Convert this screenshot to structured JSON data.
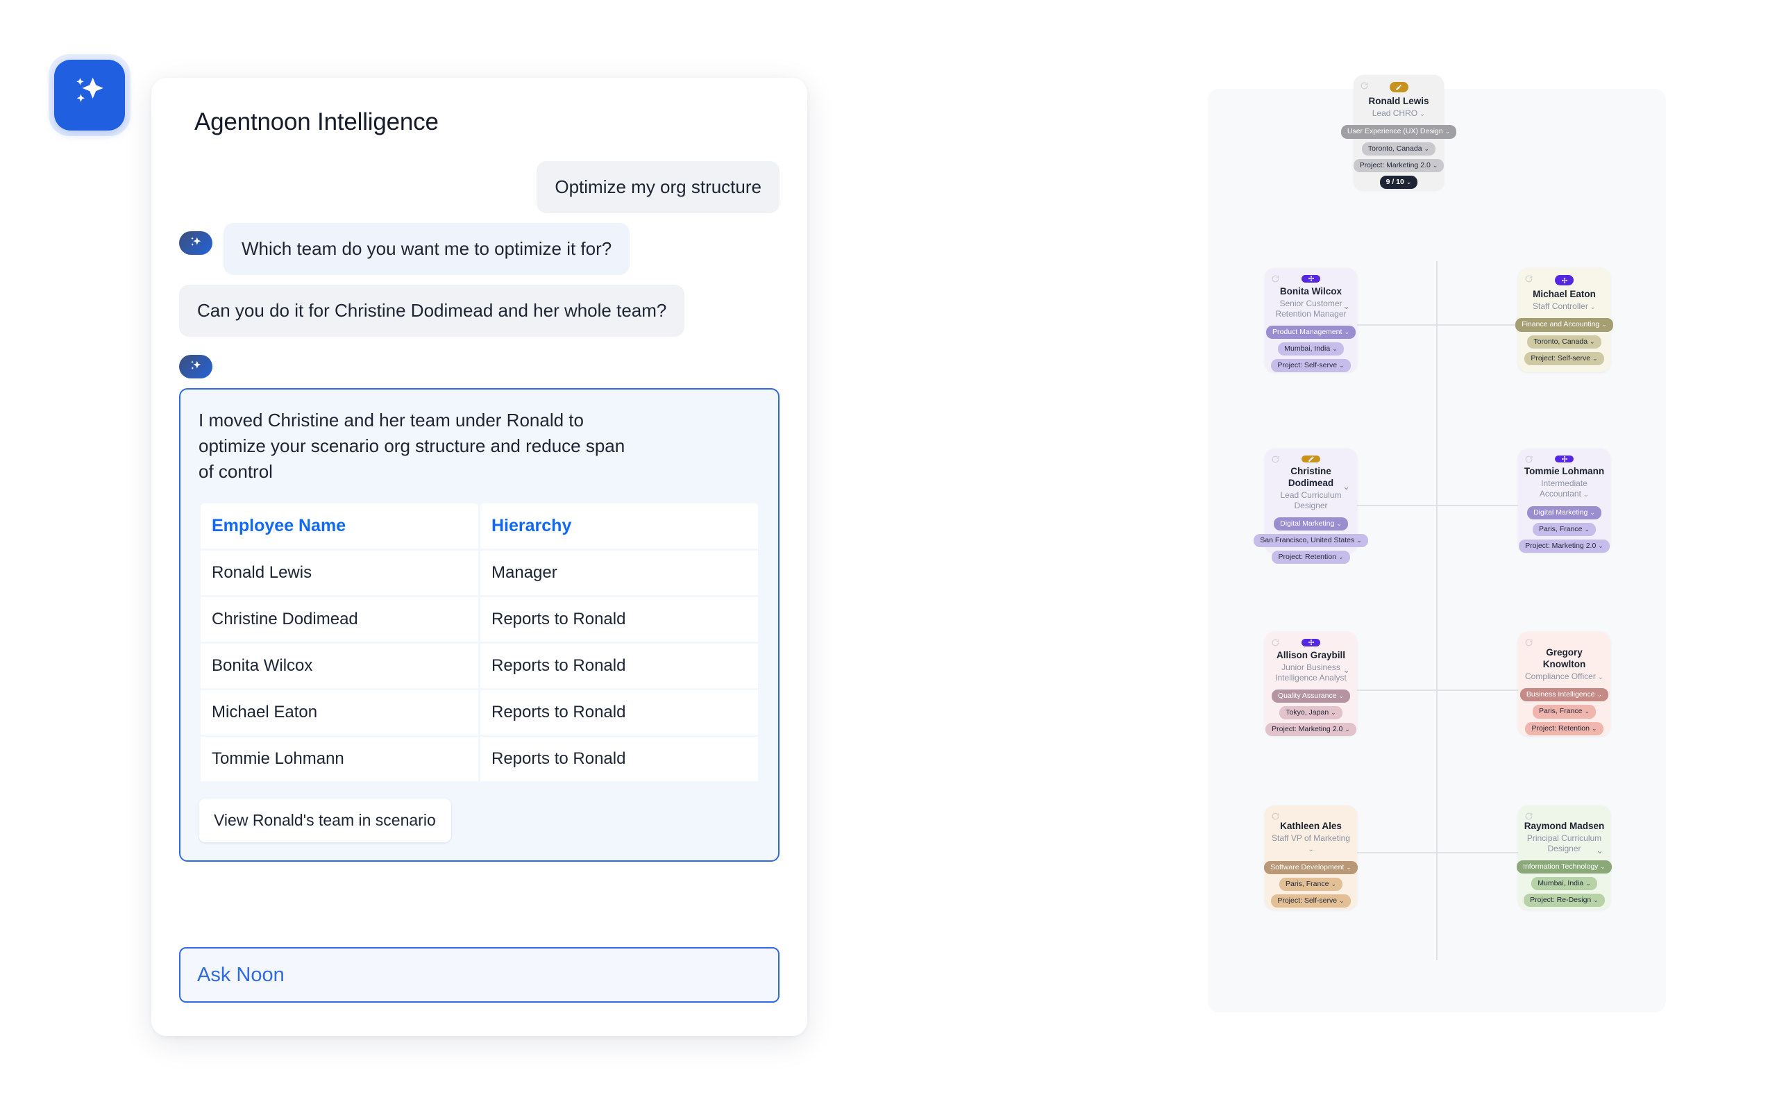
{
  "launcher": {
    "icon": "sparkle-icon"
  },
  "chat": {
    "title": "Agentnoon Intelligence",
    "messages": [
      {
        "role": "user",
        "text": "Optimize my org structure"
      },
      {
        "role": "assistant",
        "text": "Which team do you want me to optimize it for?"
      },
      {
        "role": "user",
        "text": "Can you do it for Christine Dodimead and her whole team?"
      }
    ],
    "answer": {
      "text": "I moved Christine and her team under Ronald to optimize your scenario org structure and reduce span of control",
      "table": {
        "headers": [
          "Employee Name",
          "Hierarchy"
        ],
        "rows": [
          [
            "Ronald Lewis",
            "Manager"
          ],
          [
            "Christine Dodimead",
            "Reports to Ronald"
          ],
          [
            "Bonita Wilcox",
            "Reports to Ronald"
          ],
          [
            "Michael Eaton",
            "Reports to Ronald"
          ],
          [
            "Tommie Lohmann",
            "Reports to Ronald"
          ]
        ]
      },
      "cta_label": "View Ronald's team in scenario"
    },
    "input": {
      "placeholder": "Ask Noon",
      "value": ""
    }
  },
  "org_chart": {
    "nodes": [
      {
        "name": "Ronald Lewis",
        "title": "Lead CHRO",
        "badge": "edit-icon",
        "chips": [
          {
            "label": "User Experience (UX) Design",
            "style": "dept"
          },
          {
            "label": "Toronto, Canada",
            "style": "meta"
          },
          {
            "label": "Project: Marketing 2.0",
            "style": "meta"
          }
        ],
        "count_chip": "9 / 10",
        "colors": {
          "bg": "#f1f1f1",
          "dept": "#a0a0a4",
          "meta": "#c9c9cd"
        }
      },
      {
        "name": "Bonita Wilcox",
        "title": "Senior Customer Retention Manager",
        "badge": "move-icon",
        "chips": [
          {
            "label": "Product Management",
            "style": "dept"
          },
          {
            "label": "Mumbai, India",
            "style": "meta"
          },
          {
            "label": "Project: Self-serve",
            "style": "meta"
          }
        ],
        "colors": {
          "bg": "#f2effb",
          "dept": "#9b8ed0",
          "meta": "#c7bdea"
        }
      },
      {
        "name": "Michael Eaton",
        "title": "Staff Controller",
        "badge": "move-icon",
        "chips": [
          {
            "label": "Finance and Accounting",
            "style": "dept"
          },
          {
            "label": "Toronto, Canada",
            "style": "meta"
          },
          {
            "label": "Project: Self-serve",
            "style": "meta"
          }
        ],
        "colors": {
          "bg": "#f7f6e8",
          "dept": "#a49e72",
          "meta": "#cfcaa3"
        }
      },
      {
        "name": "Christine Dodimead",
        "title": "Lead Curriculum Designer",
        "badge": "edit-icon",
        "chips": [
          {
            "label": "Digital Marketing",
            "style": "dept"
          },
          {
            "label": "San Francisco, United States",
            "style": "meta"
          },
          {
            "label": "Project: Retention",
            "style": "meta"
          }
        ],
        "colors": {
          "bg": "#f2effb",
          "dept": "#9b8ed0",
          "meta": "#c7bdea"
        }
      },
      {
        "name": "Tommie Lohmann",
        "title": "Intermediate Accountant",
        "badge": "move-icon",
        "chips": [
          {
            "label": "Digital Marketing",
            "style": "dept"
          },
          {
            "label": "Paris, France",
            "style": "meta"
          },
          {
            "label": "Project: Marketing 2.0",
            "style": "meta"
          }
        ],
        "colors": {
          "bg": "#f2effb",
          "dept": "#9b8ed0",
          "meta": "#c7bdea"
        }
      },
      {
        "name": "Allison Graybill",
        "title": "Junior Business Intelligence Analyst",
        "badge": "move-icon",
        "chips": [
          {
            "label": "Quality Assurance",
            "style": "dept"
          },
          {
            "label": "Tokyo, Japan",
            "style": "meta"
          },
          {
            "label": "Project: Marketing 2.0",
            "style": "meta"
          }
        ],
        "colors": {
          "bg": "#fbeff1",
          "dept": "#b494a0",
          "meta": "#e2c3cb"
        }
      },
      {
        "name": "Gregory Knowlton",
        "title": "Compliance Officer",
        "badge": "none",
        "chips": [
          {
            "label": "Business Intelligence",
            "style": "dept"
          },
          {
            "label": "Paris, France",
            "style": "meta"
          },
          {
            "label": "Project: Retention",
            "style": "meta"
          }
        ],
        "colors": {
          "bg": "#fdeeeb",
          "dept": "#c58a86",
          "meta": "#f0b5ad"
        }
      },
      {
        "name": "Kathleen Ales",
        "title": "Staff VP of Marketing",
        "badge": "none",
        "chips": [
          {
            "label": "Software Development",
            "style": "dept"
          },
          {
            "label": "Paris, France",
            "style": "meta"
          },
          {
            "label": "Project: Self-serve",
            "style": "meta"
          }
        ],
        "colors": {
          "bg": "#fbeee2",
          "dept": "#b89877",
          "meta": "#e3bf96"
        }
      },
      {
        "name": "Raymond Madsen",
        "title": "Principal Curriculum Designer",
        "badge": "none",
        "chips": [
          {
            "label": "Information Technology",
            "style": "dept"
          },
          {
            "label": "Mumbai, India",
            "style": "meta"
          },
          {
            "label": "Project: Re-Design",
            "style": "meta"
          }
        ],
        "colors": {
          "bg": "#eef5e9",
          "dept": "#8aa878",
          "meta": "#b7d2a6"
        }
      }
    ]
  },
  "colors": {
    "accent": "#1f5fe0",
    "link": "#1169f2",
    "user_bubble": "#f1f2f5",
    "assistant_bubble": "#eef3fc",
    "card_bg": "#f2f6fd",
    "panel_bg": "#f8f9fb"
  }
}
